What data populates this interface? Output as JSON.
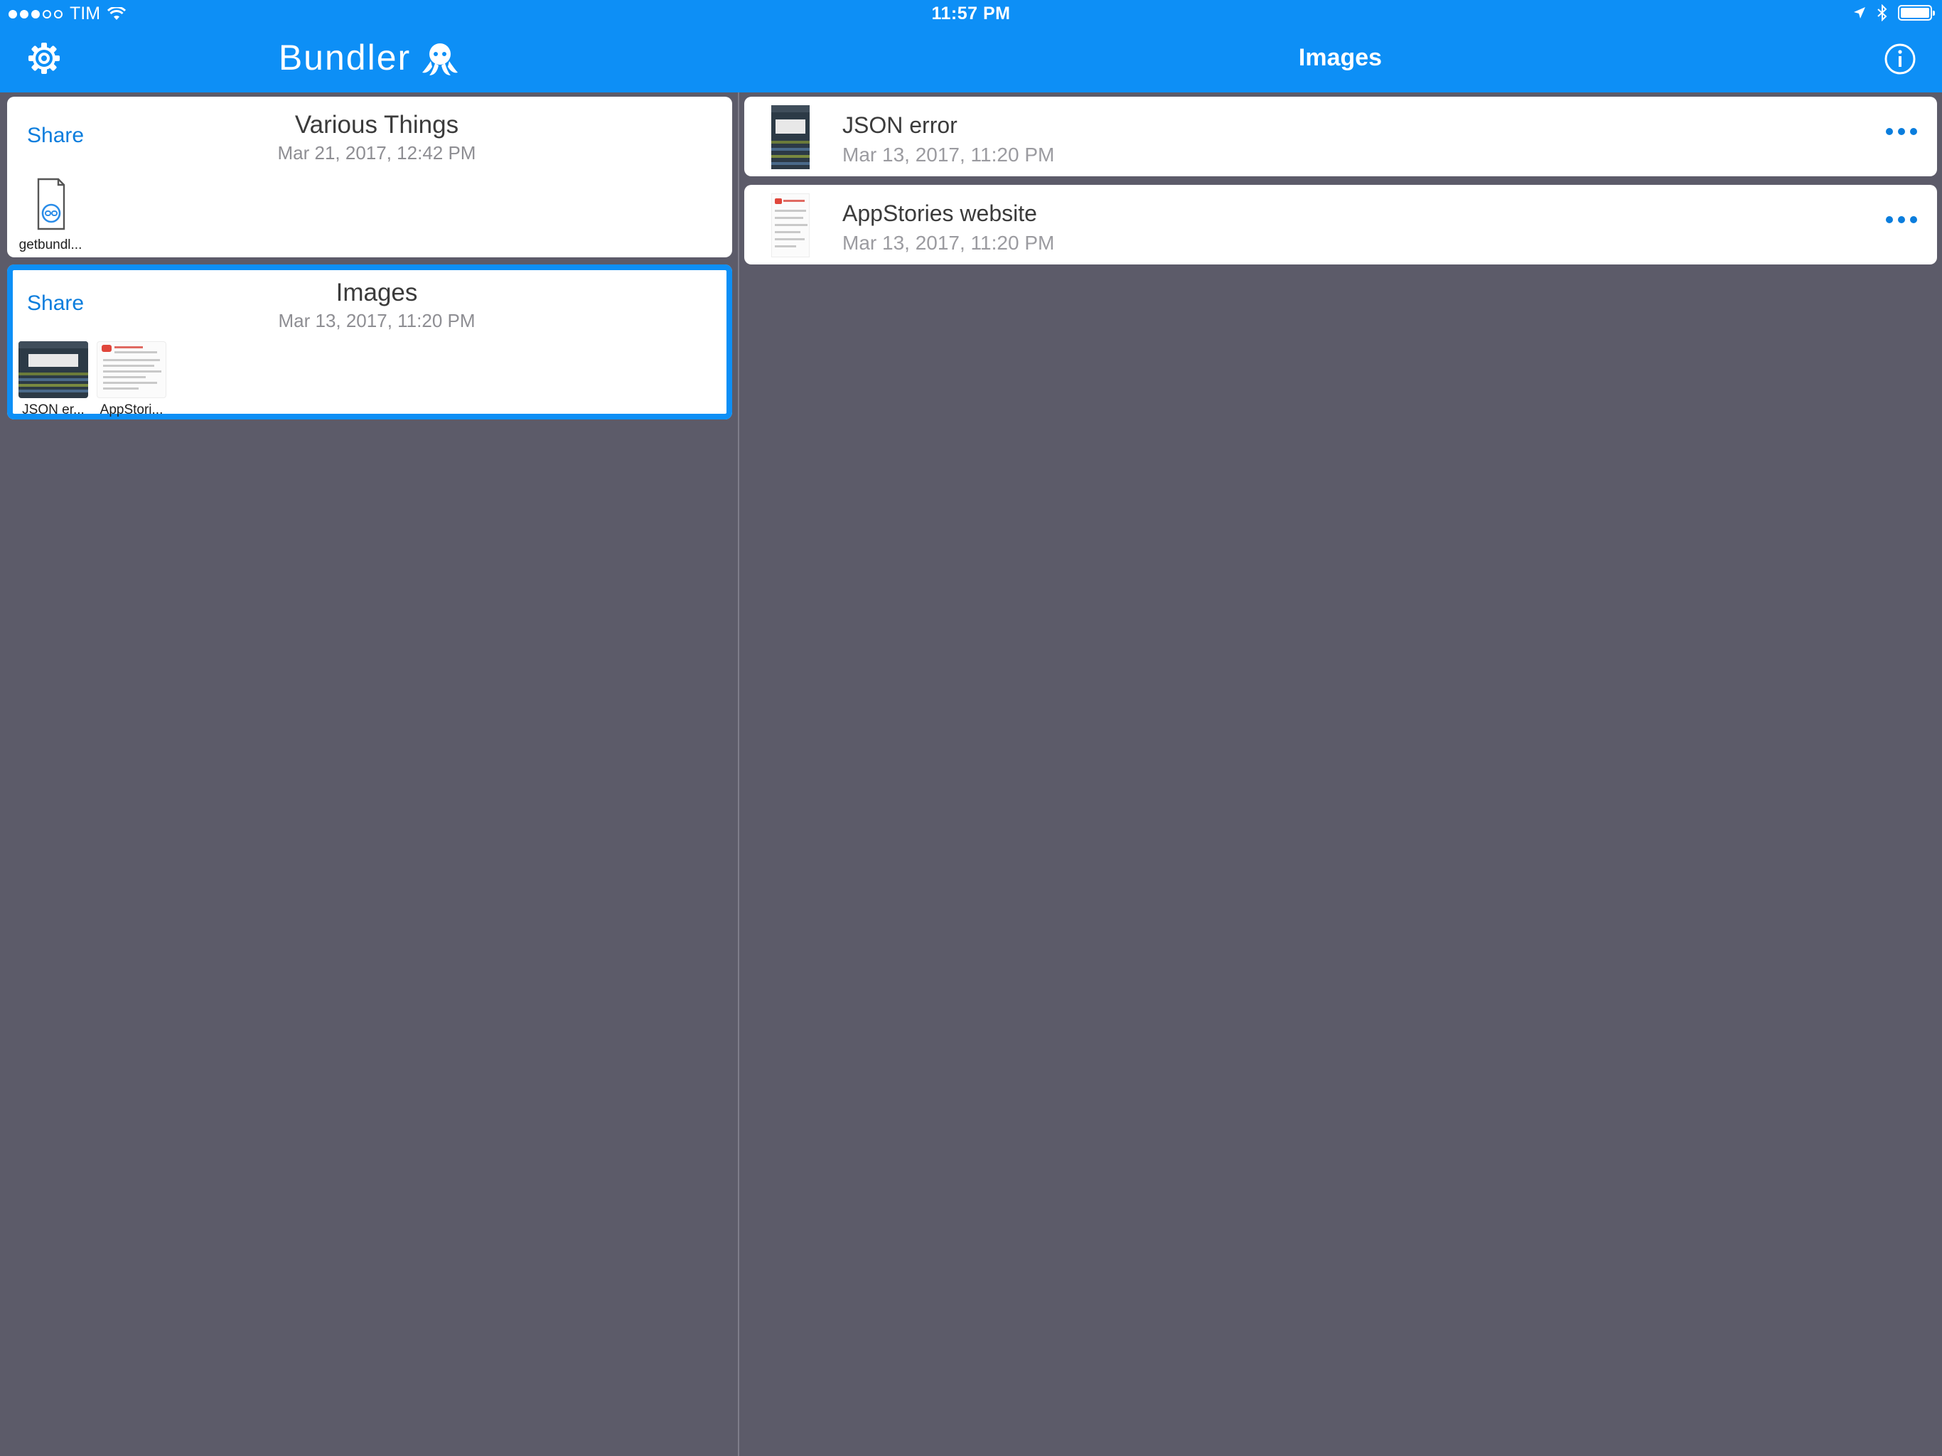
{
  "status": {
    "carrier": "TIM",
    "time": "11:57 PM"
  },
  "sidebar": {
    "app_title": "Bundler",
    "bundles": [
      {
        "share_label": "Share",
        "title": "Various Things",
        "date": "Mar 21, 2017, 12:42 PM",
        "items": [
          {
            "label": "getbundl..."
          }
        ]
      },
      {
        "share_label": "Share",
        "title": "Images",
        "date": "Mar 13, 2017, 11:20 PM",
        "items": [
          {
            "label": "JSON er..."
          },
          {
            "label": "AppStori..."
          }
        ]
      }
    ]
  },
  "detail": {
    "title": "Images",
    "items": [
      {
        "name": "JSON error",
        "date": "Mar 13, 2017, 11:20 PM"
      },
      {
        "name": "AppStories website",
        "date": "Mar 13, 2017, 11:20 PM"
      }
    ]
  },
  "colors": {
    "accent": "#0d8ff6",
    "link": "#0a7ddd",
    "background": "#5c5b69"
  }
}
